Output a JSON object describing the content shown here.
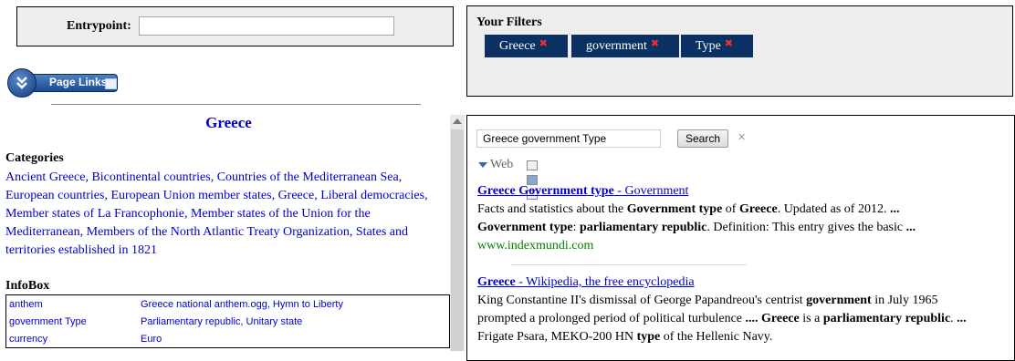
{
  "entrypoint": {
    "label": "Entrypoint:",
    "value": ""
  },
  "page_links": {
    "label": "Page Links"
  },
  "article": {
    "title": "Greece",
    "categories_heading": "Categories",
    "categories_text": "Ancient Greece, Bicontinental countries, Countries of the Mediterranean Sea, European countries, European Union member states, Greece, Liberal democracies, Member states of La Francophonie, Member states of the Union for the Mediterranean, Members of the North Atlantic Treaty Organization, States and territories established in 1821",
    "infobox_heading": "InfoBox",
    "infobox_rows": [
      {
        "key": "anthem",
        "value": "Greece national anthem.ogg, Hymn to Liberty"
      },
      {
        "key": "government Type",
        "value": "Parliamentary republic, Unitary state"
      },
      {
        "key": "currency",
        "value": "Euro"
      }
    ]
  },
  "filters": {
    "heading": "Your Filters",
    "chips": [
      {
        "label": "Greece",
        "remove_icon": "close-icon"
      },
      {
        "label": "government",
        "remove_icon": "close-icon"
      },
      {
        "label": "Type",
        "remove_icon": "close-icon"
      }
    ]
  },
  "search": {
    "query": "Greece government Type",
    "button_label": "Search",
    "clear_symbol": "✕",
    "web_label": "Web"
  },
  "results": [
    {
      "title_bold": "Greece Government type",
      "title_rest": " - Government",
      "snippet_html": "Facts and statistics about the <b>Government type</b> of <b>Greece</b>. Updated as of 2012. <b>...</b><br><b>Government type</b>: <b>parliamentary republic</b>. Definition: This entry gives the basic <b>...</b>",
      "url": "www.indexmundi.com"
    },
    {
      "title_bold": "Greece",
      "title_rest": " - Wikipedia, the free encyclopedia",
      "snippet_html": "King Constantine II's dismissal of George Papandreou's centrist <b>government</b> in July 1965<br>prompted a prolonged period of political turbulence <b>....</b> <b>Greece</b> is a <b>parliamentary republic</b>. <b>...</b><br>Frigate Psara, MEKO-200 HN <b>type</b> of the Hellenic Navy.",
      "url": ""
    }
  ],
  "colors": {
    "chip_background": "#0b3163",
    "chip_remove": "#ff2a2a",
    "link": "#0000cc",
    "result_url": "#008000",
    "panel_background": "#eeeeee"
  }
}
